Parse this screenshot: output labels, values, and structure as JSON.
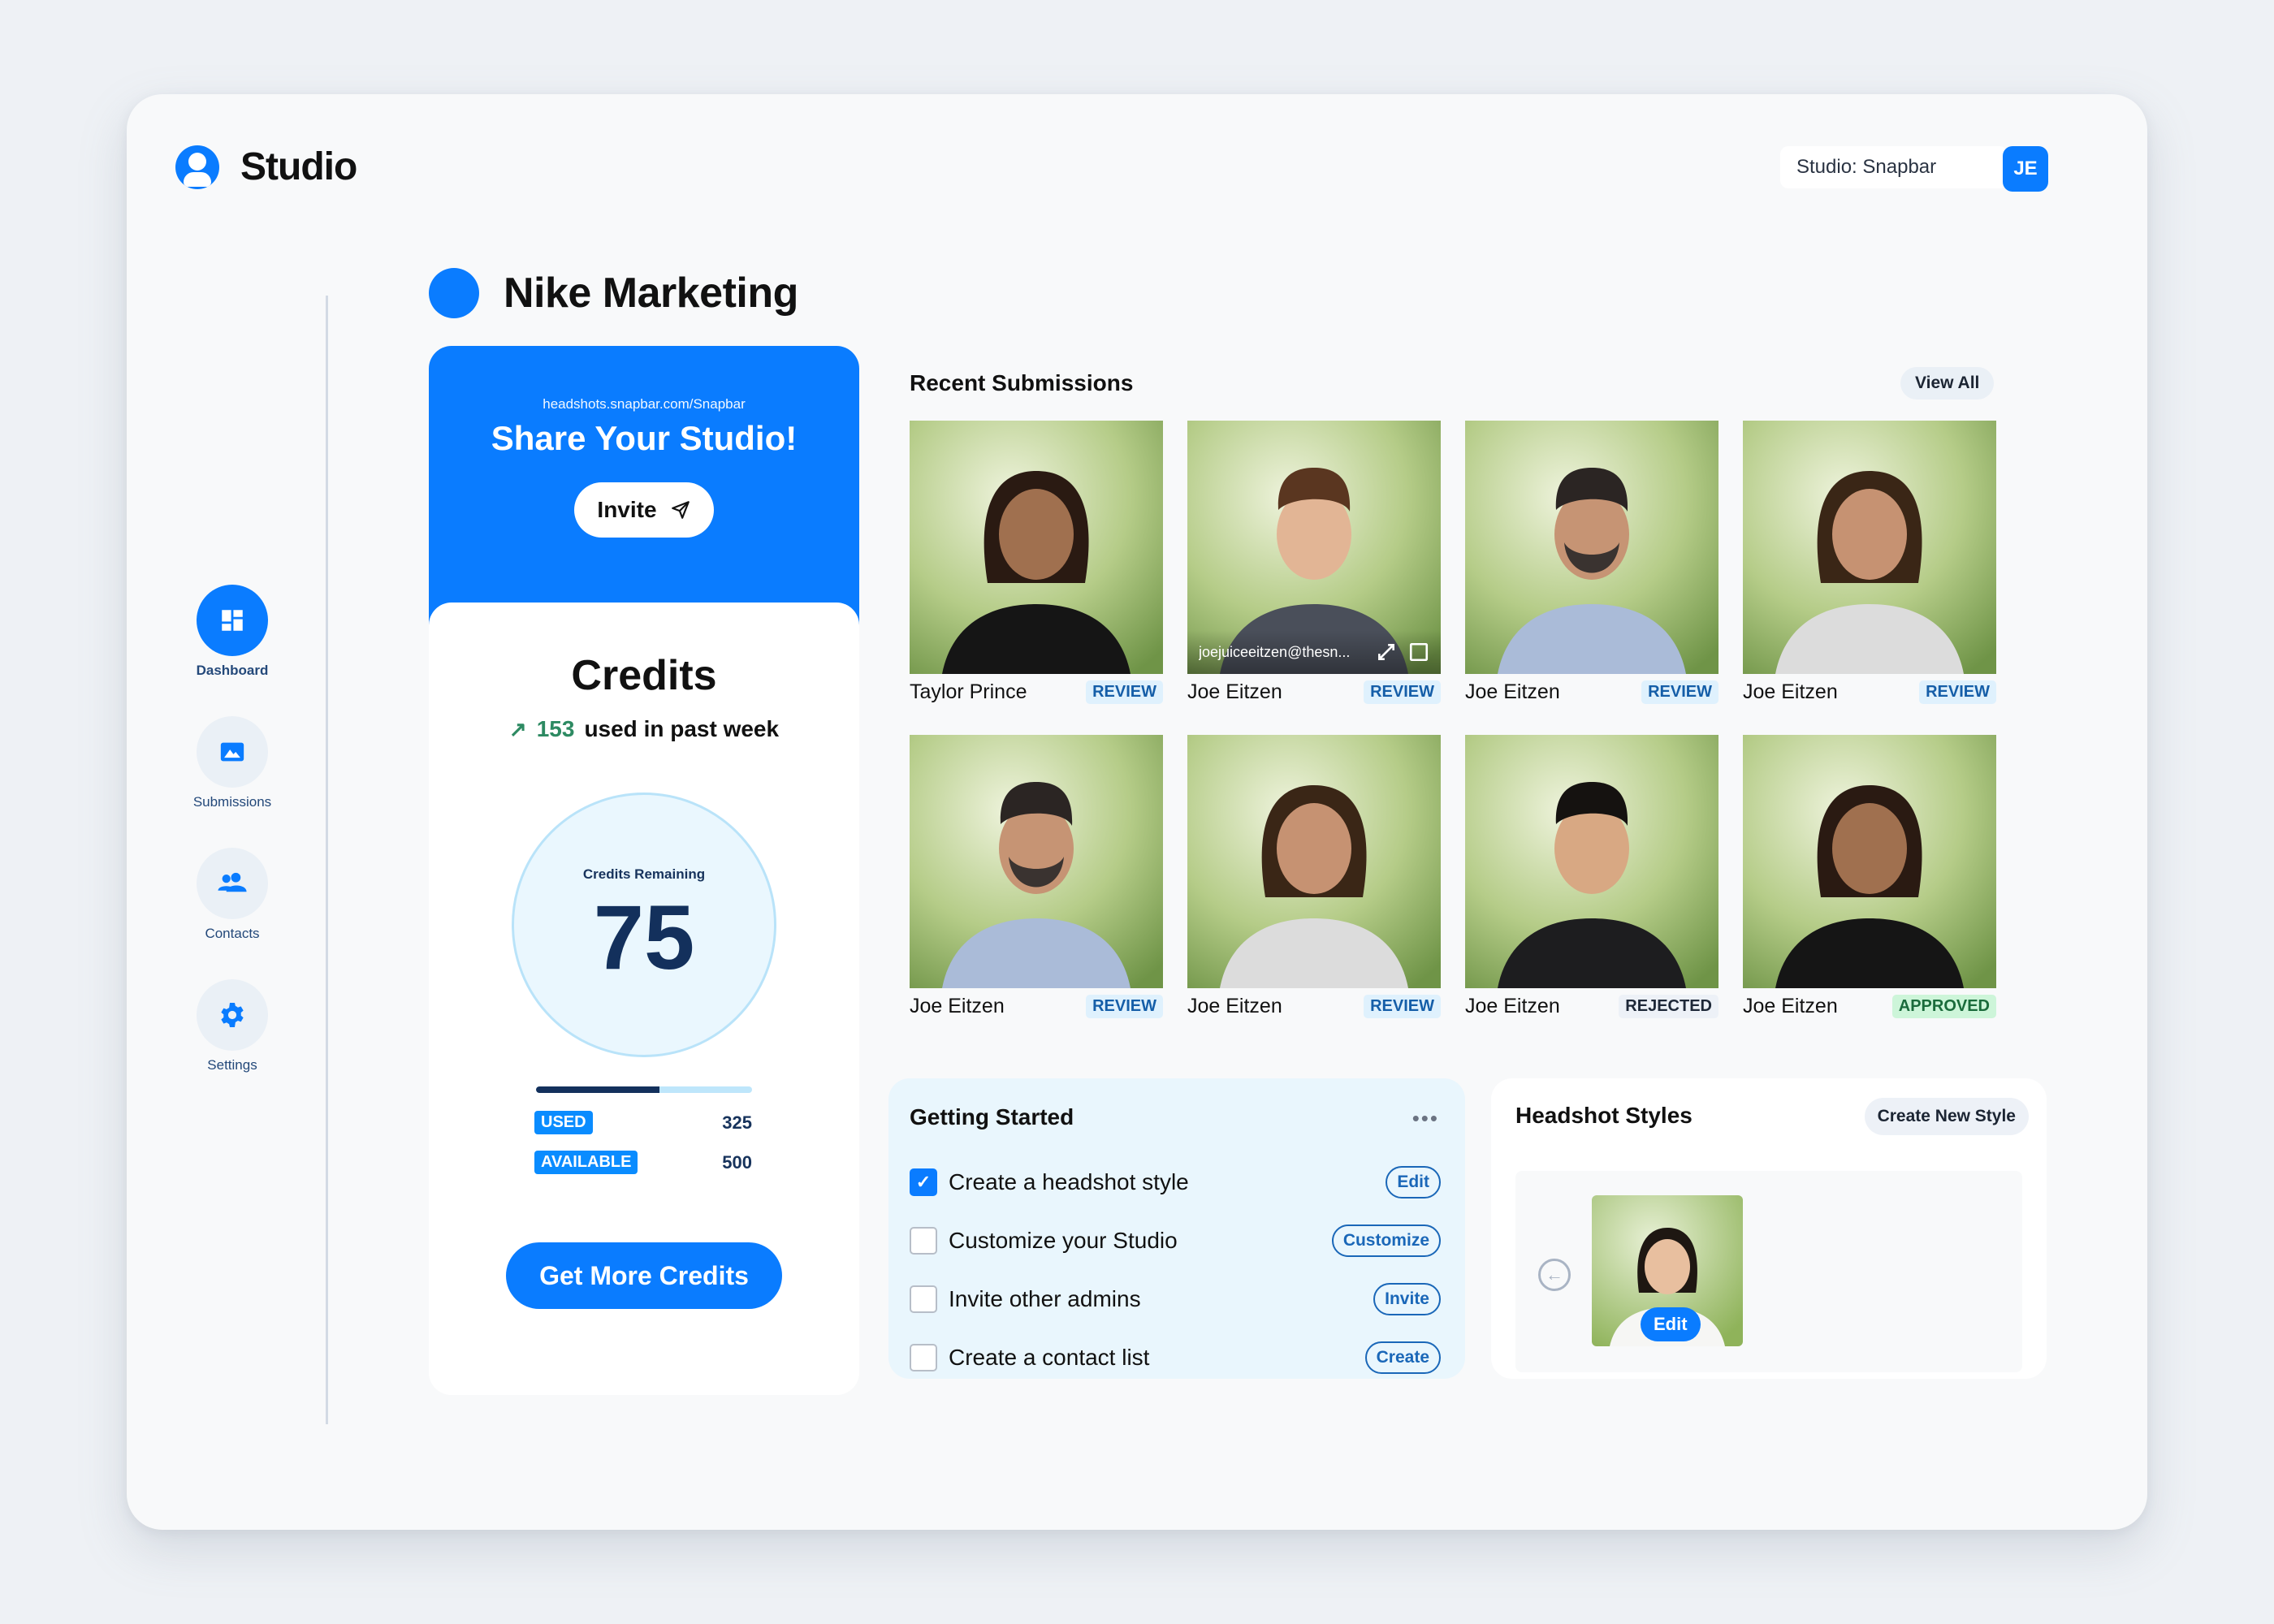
{
  "app": {
    "name": "Studio",
    "studio_selector": "Studio: Snapbar",
    "user_initials": "JE",
    "accent": "#0a7cff"
  },
  "sidebar": {
    "items": [
      {
        "label": "Dashboard",
        "icon": "dashboard-icon",
        "active": true
      },
      {
        "label": "Submissions",
        "icon": "image-icon",
        "active": false
      },
      {
        "label": "Contacts",
        "icon": "users-icon",
        "active": false
      },
      {
        "label": "Settings",
        "icon": "gear-icon",
        "active": false
      }
    ]
  },
  "page": {
    "title": "Nike Marketing"
  },
  "share": {
    "url": "headshots.snapbar.com/Snapbar",
    "title": "Share Your Studio!",
    "invite_label": "Invite"
  },
  "credits": {
    "title": "Credits",
    "weekly_used": "153",
    "weekly_suffix": "used in past week",
    "remaining_label": "Credits Remaining",
    "remaining": "75",
    "bar_fill": 0.57,
    "used_label": "USED",
    "used_value": "325",
    "available_label": "AVAILABLE",
    "available_value": "500",
    "cta": "Get More Credits"
  },
  "submissions": {
    "title": "Recent Submissions",
    "view_all": "View All",
    "items": [
      {
        "name": "Taylor Prince",
        "status": "REVIEW",
        "kind": "review"
      },
      {
        "name": "Joe Eitzen",
        "status": "REVIEW",
        "kind": "review",
        "hover_email": "joejuiceeitzen@thesn..."
      },
      {
        "name": "Joe Eitzen",
        "status": "REVIEW",
        "kind": "review"
      },
      {
        "name": "Joe Eitzen",
        "status": "REVIEW",
        "kind": "review"
      },
      {
        "name": "Joe Eitzen",
        "status": "REVIEW",
        "kind": "review"
      },
      {
        "name": "Joe Eitzen",
        "status": "REVIEW",
        "kind": "review"
      },
      {
        "name": "Joe Eitzen",
        "status": "REJECTED",
        "kind": "rejected"
      },
      {
        "name": "Joe Eitzen",
        "status": "APPROVED",
        "kind": "approved"
      }
    ]
  },
  "getting_started": {
    "title": "Getting Started",
    "tasks": [
      {
        "label": "Create a headshot style",
        "done": true,
        "action": "Edit"
      },
      {
        "label": "Customize your Studio",
        "done": false,
        "action": "Customize"
      },
      {
        "label": "Invite other admins",
        "done": false,
        "action": "Invite"
      },
      {
        "label": "Create a contact list",
        "done": false,
        "action": "Create"
      }
    ]
  },
  "headshot_styles": {
    "title": "Headshot Styles",
    "create_label": "Create New Style",
    "edit_label": "Edit"
  }
}
